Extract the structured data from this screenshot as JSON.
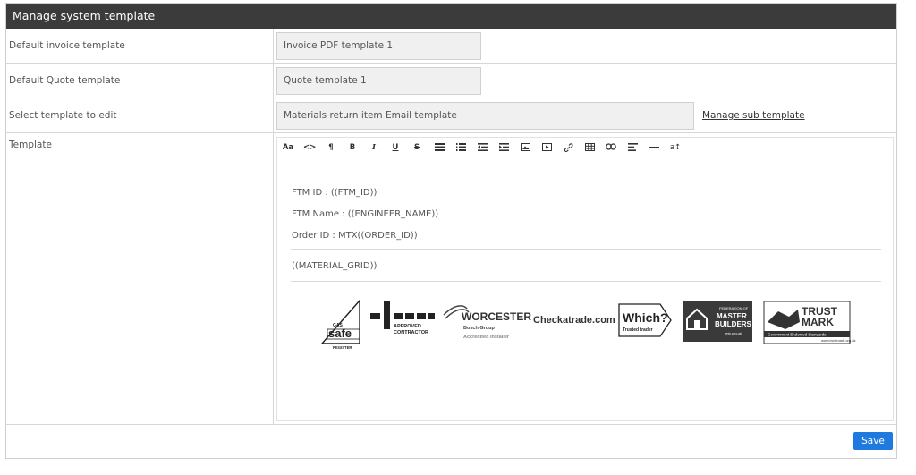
{
  "header": {
    "title": "Manage system template"
  },
  "form": {
    "invoice": {
      "label": "Default invoice template",
      "value": "Invoice PDF template 1"
    },
    "quote": {
      "label": "Default Quote template",
      "value": "Quote template 1"
    },
    "edit": {
      "label": "Select template to edit",
      "value": "Materials return item Email template",
      "link": "Manage sub template"
    },
    "template": {
      "label": "Template"
    }
  },
  "toolbar": {
    "items": [
      "Aa",
      "<>",
      "¶",
      "B",
      "I",
      "U",
      "S",
      "unordered-list",
      "ordered-list",
      "outdent",
      "indent",
      "image",
      "video",
      "link",
      "table",
      "embed-link",
      "align",
      "horizontal-rule",
      "a↕"
    ]
  },
  "editor": {
    "lines": [
      "FTM ID : ((FTM_ID))",
      "FTM Name : ((ENGINEER_NAME))",
      "Order ID : MTX((ORDER_ID))",
      "((MATERIAL_GRID))"
    ],
    "logos": {
      "gassafe": {
        "text": "safe",
        "small_top": "GAS",
        "small_bottom": "REGISTER"
      },
      "niceic": {
        "line1": "APPROVED",
        "line2": "CONTRACTOR"
      },
      "worcester": {
        "name": "WORCESTER",
        "group": "Bosch Group",
        "sub": "Accredited Installer"
      },
      "checkatrade": {
        "text": "Checkatrade.com"
      },
      "which": {
        "text": "Which?",
        "sub": "Trusted trader"
      },
      "fmb": {
        "line1": "FEDERATION OF",
        "line2": "MASTER",
        "line3": "BUILDERS",
        "url": "fmb.org.uk"
      },
      "trustmark": {
        "line1": "TRUST",
        "line2": "MARK",
        "tagline": "Government Endorsed Standards",
        "url": "www.trustmark.org.uk"
      }
    }
  },
  "actions": {
    "save": "Save"
  },
  "colors": {
    "header_bg": "#3b3b3b",
    "primary": "#1f7ae0",
    "input_bg": "#f0f0f0"
  }
}
